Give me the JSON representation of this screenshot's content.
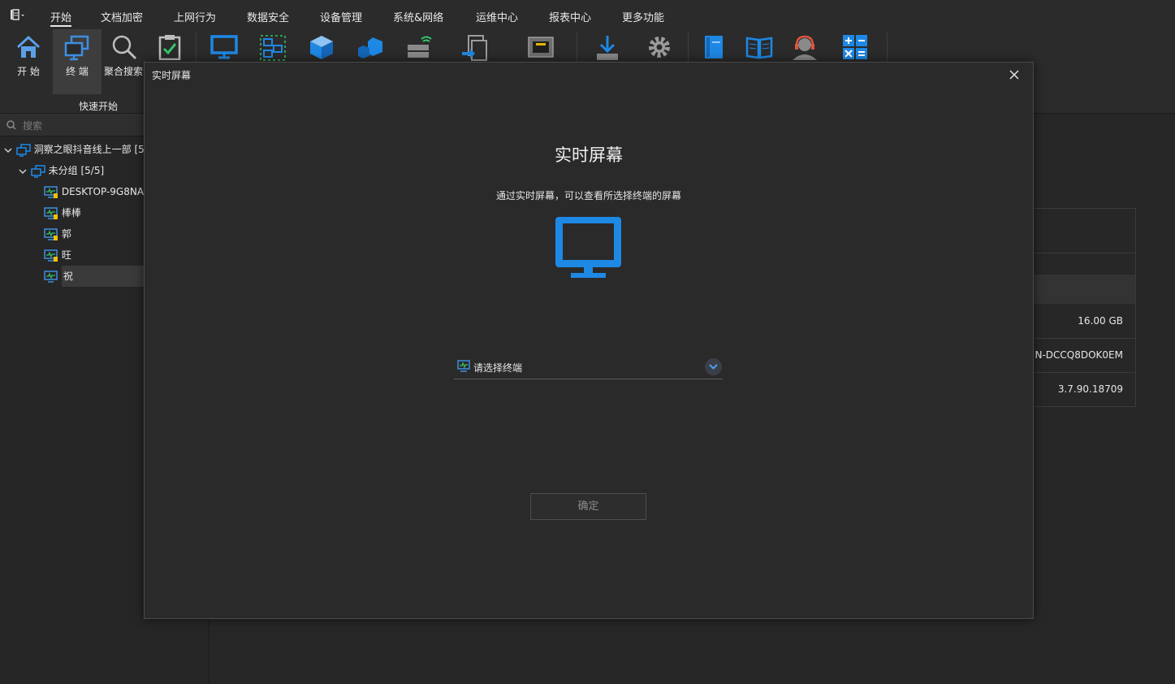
{
  "menu": {
    "items": [
      "开始",
      "文档加密",
      "上网行为",
      "数据安全",
      "设备管理",
      "系统&网络",
      "运维中心",
      "报表中心",
      "更多功能"
    ],
    "active_index": 0
  },
  "ribbon": {
    "buttons": [
      {
        "label": "开 始",
        "icon": "home-icon"
      },
      {
        "label": "终 端",
        "icon": "terminal-icon",
        "selected": true
      },
      {
        "label": "聚合搜索",
        "icon": "search-icon"
      },
      {
        "label": "",
        "icon": "clipboard-check-icon"
      },
      {
        "label": "",
        "icon": "monitor-icon"
      },
      {
        "label": "",
        "icon": "network-select-icon"
      },
      {
        "label": "",
        "icon": "cube-icon"
      },
      {
        "label": "",
        "icon": "cubes-icon"
      },
      {
        "label": "",
        "icon": "server-wireless-icon"
      },
      {
        "label": "",
        "icon": "document-transfer-icon"
      },
      {
        "label": "",
        "icon": "network-port-icon"
      },
      {
        "label": "",
        "icon": "download-icon"
      },
      {
        "label": "",
        "icon": "gear-icon"
      },
      {
        "label": "",
        "icon": "book-icon"
      },
      {
        "label": "",
        "icon": "open-book-icon"
      },
      {
        "label": "",
        "icon": "support-agent-icon"
      },
      {
        "label": "",
        "icon": "calculator-icon"
      }
    ],
    "group_label": "快速开始"
  },
  "sidebar": {
    "search_placeholder": "搜索",
    "tree": {
      "root": "洞察之眼抖音线上一部  [5",
      "group": "未分组  [5/5]",
      "terminals": [
        "DESKTOP-9G8NA",
        "棒棒",
        "郭",
        "旺",
        "祝"
      ],
      "selected_index": 4
    }
  },
  "details": {
    "memory": "16.00 GB",
    "computer_name": "N-DCCQ8DOK0EM",
    "version": "3.7.90.18709"
  },
  "dialog": {
    "window_title": "实时屏幕",
    "heading": "实时屏幕",
    "description": "通过实时屏幕，可以查看所选择终端的屏幕",
    "select_placeholder": "请选择终端",
    "confirm_label": "确定"
  },
  "colors": {
    "accent_blue": "#1e88e5",
    "background": "#272727",
    "dialog_bg": "#2a2a2a",
    "warn_yellow": "#f2c200",
    "check_green": "#35c46a",
    "headset_red": "#e2533b"
  }
}
